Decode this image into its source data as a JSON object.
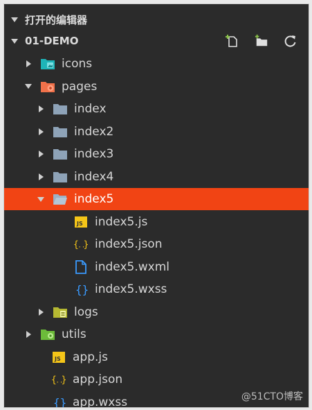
{
  "header": {
    "title": "打开的编辑器"
  },
  "project": {
    "title": "01-DEMO"
  },
  "tree": [
    {
      "label": "icons",
      "icon": "folder-image-icon",
      "arrow": "right",
      "depth": 1
    },
    {
      "label": "pages",
      "icon": "folder-pages-icon",
      "arrow": "down",
      "depth": 1
    },
    {
      "label": "index",
      "icon": "folder-icon",
      "arrow": "right",
      "depth": 2
    },
    {
      "label": "index2",
      "icon": "folder-icon",
      "arrow": "right",
      "depth": 2
    },
    {
      "label": "index3",
      "icon": "folder-icon",
      "arrow": "right",
      "depth": 2
    },
    {
      "label": "index4",
      "icon": "folder-icon",
      "arrow": "right",
      "depth": 2
    },
    {
      "label": "index5",
      "icon": "folder-open-icon",
      "arrow": "down",
      "depth": 2,
      "selected": true
    },
    {
      "label": "index5.js",
      "icon": "js-file-icon",
      "arrow": "none",
      "depth": 3
    },
    {
      "label": "index5.json",
      "icon": "json-file-icon",
      "arrow": "none",
      "depth": 3
    },
    {
      "label": "index5.wxml",
      "icon": "wxml-file-icon",
      "arrow": "none",
      "depth": 3
    },
    {
      "label": "index5.wxss",
      "icon": "wxss-file-icon",
      "arrow": "none",
      "depth": 3
    },
    {
      "label": "logs",
      "icon": "folder-logs-icon",
      "arrow": "right",
      "depth": 2
    },
    {
      "label": "utils",
      "icon": "folder-utils-icon",
      "arrow": "right",
      "depth": 1
    },
    {
      "label": "app.js",
      "icon": "js-file-icon",
      "arrow": "none",
      "depth": 1
    },
    {
      "label": "app.json",
      "icon": "json-file-icon",
      "arrow": "none",
      "depth": 1
    },
    {
      "label": "app.wxss",
      "icon": "wxss-file-icon",
      "arrow": "none",
      "depth": 1
    }
  ],
  "watermark": "@51CTO博客",
  "colors": {
    "panel": "#2b2b2b",
    "selected": "#f14414",
    "text": "#d6d6d6"
  }
}
